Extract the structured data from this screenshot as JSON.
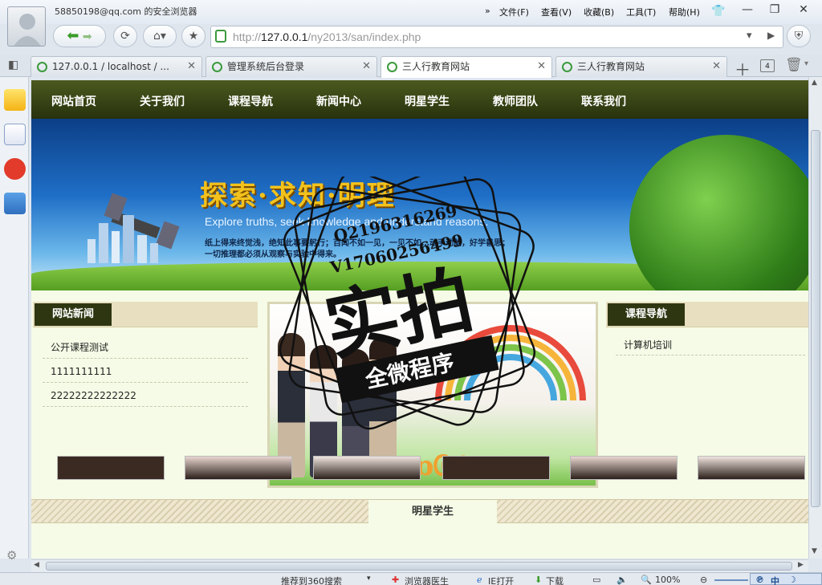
{
  "browser": {
    "account": "58850198@qq.com 的安全浏览器",
    "menu": [
      "文件(F)",
      "查看(V)",
      "收藏(B)",
      "工具(T)",
      "帮助(H)"
    ],
    "address_prefix": "http://",
    "address_host": "127.0.0.1",
    "address_path": "/ny2013/san/index.php",
    "tabs": [
      {
        "label": "127.0.0.1 / localhost / ..."
      },
      {
        "label": "管理系统后台登录"
      },
      {
        "label": "三人行教育网站"
      },
      {
        "label": "三人行教育网站"
      }
    ],
    "tab_count": "4",
    "status": {
      "search": "推荐到360搜索",
      "doctor": "浏览器医生",
      "ie": "IE打开",
      "download": "下载",
      "zoom": "100%",
      "ime": "中"
    }
  },
  "site": {
    "nav": [
      "网站首页",
      "关于我们",
      "课程导航",
      "新闻中心",
      "明星学生",
      "教师团队",
      "联系我们"
    ],
    "banner": {
      "slogan": "探索·求知·明理",
      "slogan_en": "Explore truths, seek knowledge and understand reasons.",
      "line1": "纸上得来终觉浅，绝知此事要躬行；百闻不如一见，一见不如…动手动脑，好学善思；",
      "line2": "一切推理都必须从观察与实验中得来。"
    },
    "news": {
      "title": "网站新闻",
      "items": [
        "公开课程测试",
        "1111111111",
        "22222222222222"
      ]
    },
    "courses": {
      "title": "课程导航",
      "items": [
        "计算机培训"
      ]
    },
    "stars": {
      "title": "明星学生"
    }
  },
  "watermark": {
    "qq": "Q2196316269",
    "v": "V17060256499",
    "big": "实拍",
    "small": "全微程序"
  }
}
